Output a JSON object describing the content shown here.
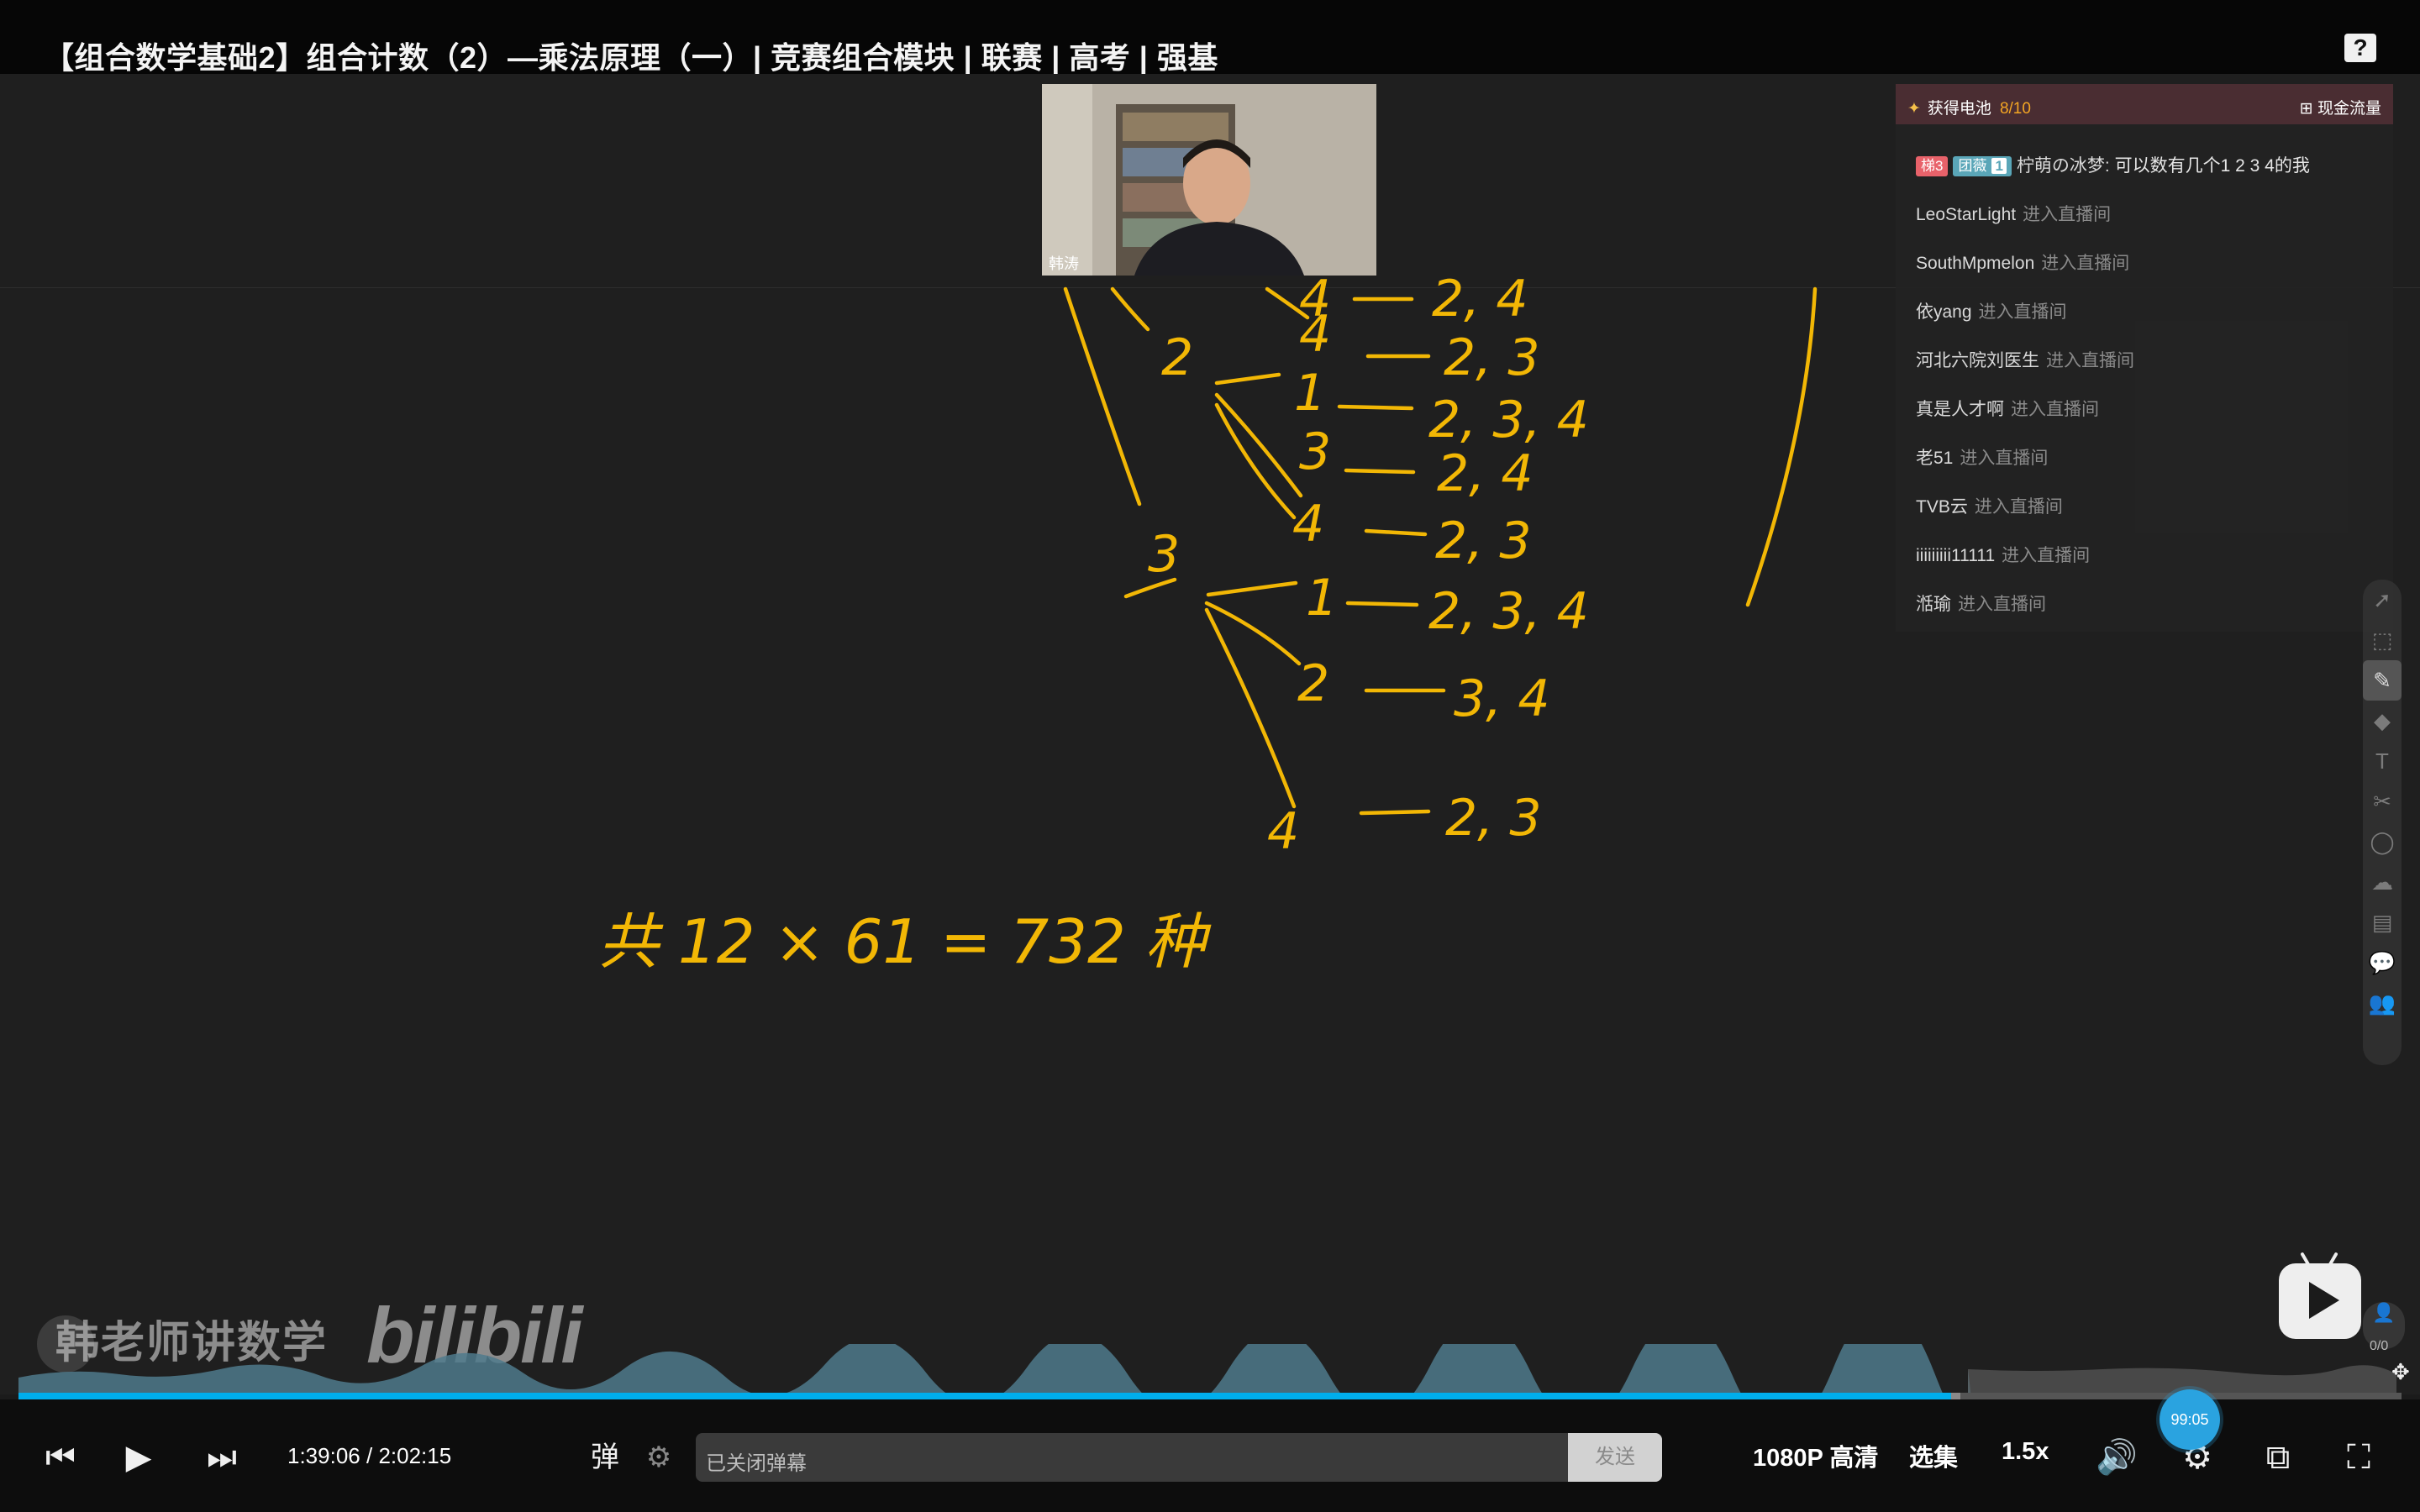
{
  "header": {
    "title": "【组合数学基础2】组合计数（2）—乘法原理（一）| 竞赛组合模块 | 联赛 | 高考 | 强基",
    "help_icon": "?"
  },
  "camera": {
    "name": "韩涛"
  },
  "chat": {
    "header_left": "获得电池",
    "battery_count": "8/10",
    "header_right": "现金流量",
    "messages": [
      {
        "badges": [
          "梯3",
          "团薇"
        ],
        "fans_level": "1",
        "user": "柠萌の冰梦:",
        "text": "可以数有几个1  2  3  4的我"
      },
      {
        "user": "LeoStarLight",
        "text": "进入直播间"
      },
      {
        "user": "SouthMpmelon",
        "text": "进入直播间"
      },
      {
        "user": "依yang",
        "text": "进入直播间"
      },
      {
        "user": "河北六院刘医生",
        "text": "进入直播间"
      },
      {
        "user": "真是人才啊",
        "text": "进入直播间"
      },
      {
        "user": "老51",
        "text": "进入直播间"
      },
      {
        "user": "TVB云",
        "text": "进入直播间"
      },
      {
        "user": "iiiiiiiii11111",
        "text": "进入直播间"
      },
      {
        "user": "湉瑜",
        "text": "进入直播间"
      }
    ]
  },
  "whiteboard": {
    "level1": [
      "2",
      "3"
    ],
    "rows": [
      {
        "first": "4",
        "rest": "2, 4"
      },
      {
        "first": "4",
        "rest": "2, 3"
      },
      {
        "first": "1",
        "rest": "2, 3, 4"
      },
      {
        "first": "3",
        "rest": "2, 4"
      },
      {
        "first": "4",
        "rest": "2, 3"
      },
      {
        "first": "1",
        "rest": "2, 3, 4"
      },
      {
        "first": "2",
        "rest": "3, 4"
      },
      {
        "first": "4",
        "rest": "2, 3"
      }
    ],
    "summary": "共 12 × 61 = 732 种"
  },
  "watermark": {
    "channel": "韩老师讲数学",
    "logo": "bilibili"
  },
  "side_panel": {
    "user_count": "0/0"
  },
  "player": {
    "current_time": "1:39:06",
    "time_separator": "/",
    "duration": "2:02:15",
    "played_fraction": 0.811,
    "buffered_fraction": 0.815,
    "danmu_placeholder": "已关闭弹幕",
    "send_label": "发送",
    "quality_label": "1080P 高清",
    "episodes_label": "选集",
    "speed_label": "1.5x",
    "speed_tip": "99:05",
    "accent_color": "#00aeec"
  }
}
